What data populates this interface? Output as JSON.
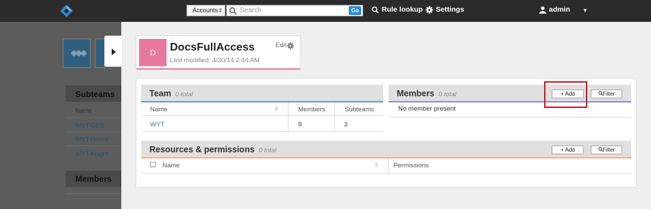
{
  "topbar": {
    "scope_select": "Accounts",
    "search_placeholder": "Search",
    "go_label": "Go",
    "rule_lookup": "Rule lookup",
    "settings": "Settings",
    "user": "admin"
  },
  "background": {
    "subteams_title": "Subteams",
    "subteams_col": "Name",
    "subteams": [
      "WYT-GDS",
      "WYT-House",
      "WYT-Knight"
    ],
    "members_title": "Members"
  },
  "group": {
    "avatar_letter": "D",
    "name": "DocsFullAccess",
    "modified": "Last modified: 4/30/14 2:44 AM",
    "edit": "Edit"
  },
  "team": {
    "title": "Team",
    "count": "0 total",
    "columns": [
      "Name",
      "Members",
      "Subteams"
    ],
    "rows": [
      {
        "name": "WYT",
        "members": "9",
        "subteams": "3"
      }
    ]
  },
  "members": {
    "title": "Members",
    "count": "0 total",
    "add": "+ Add",
    "filter": "Filter",
    "empty": "No member present"
  },
  "resources": {
    "title": "Resources & permissions",
    "count": "0 total",
    "add": "+ Add",
    "filter": "Filter",
    "columns": [
      "Name",
      "Permissions"
    ]
  },
  "colors": {
    "topbar": "#2b2b2b",
    "accent_pink": "#e8799e",
    "link_blue": "#2a7ab8",
    "highlight_red": "#d0141c"
  }
}
